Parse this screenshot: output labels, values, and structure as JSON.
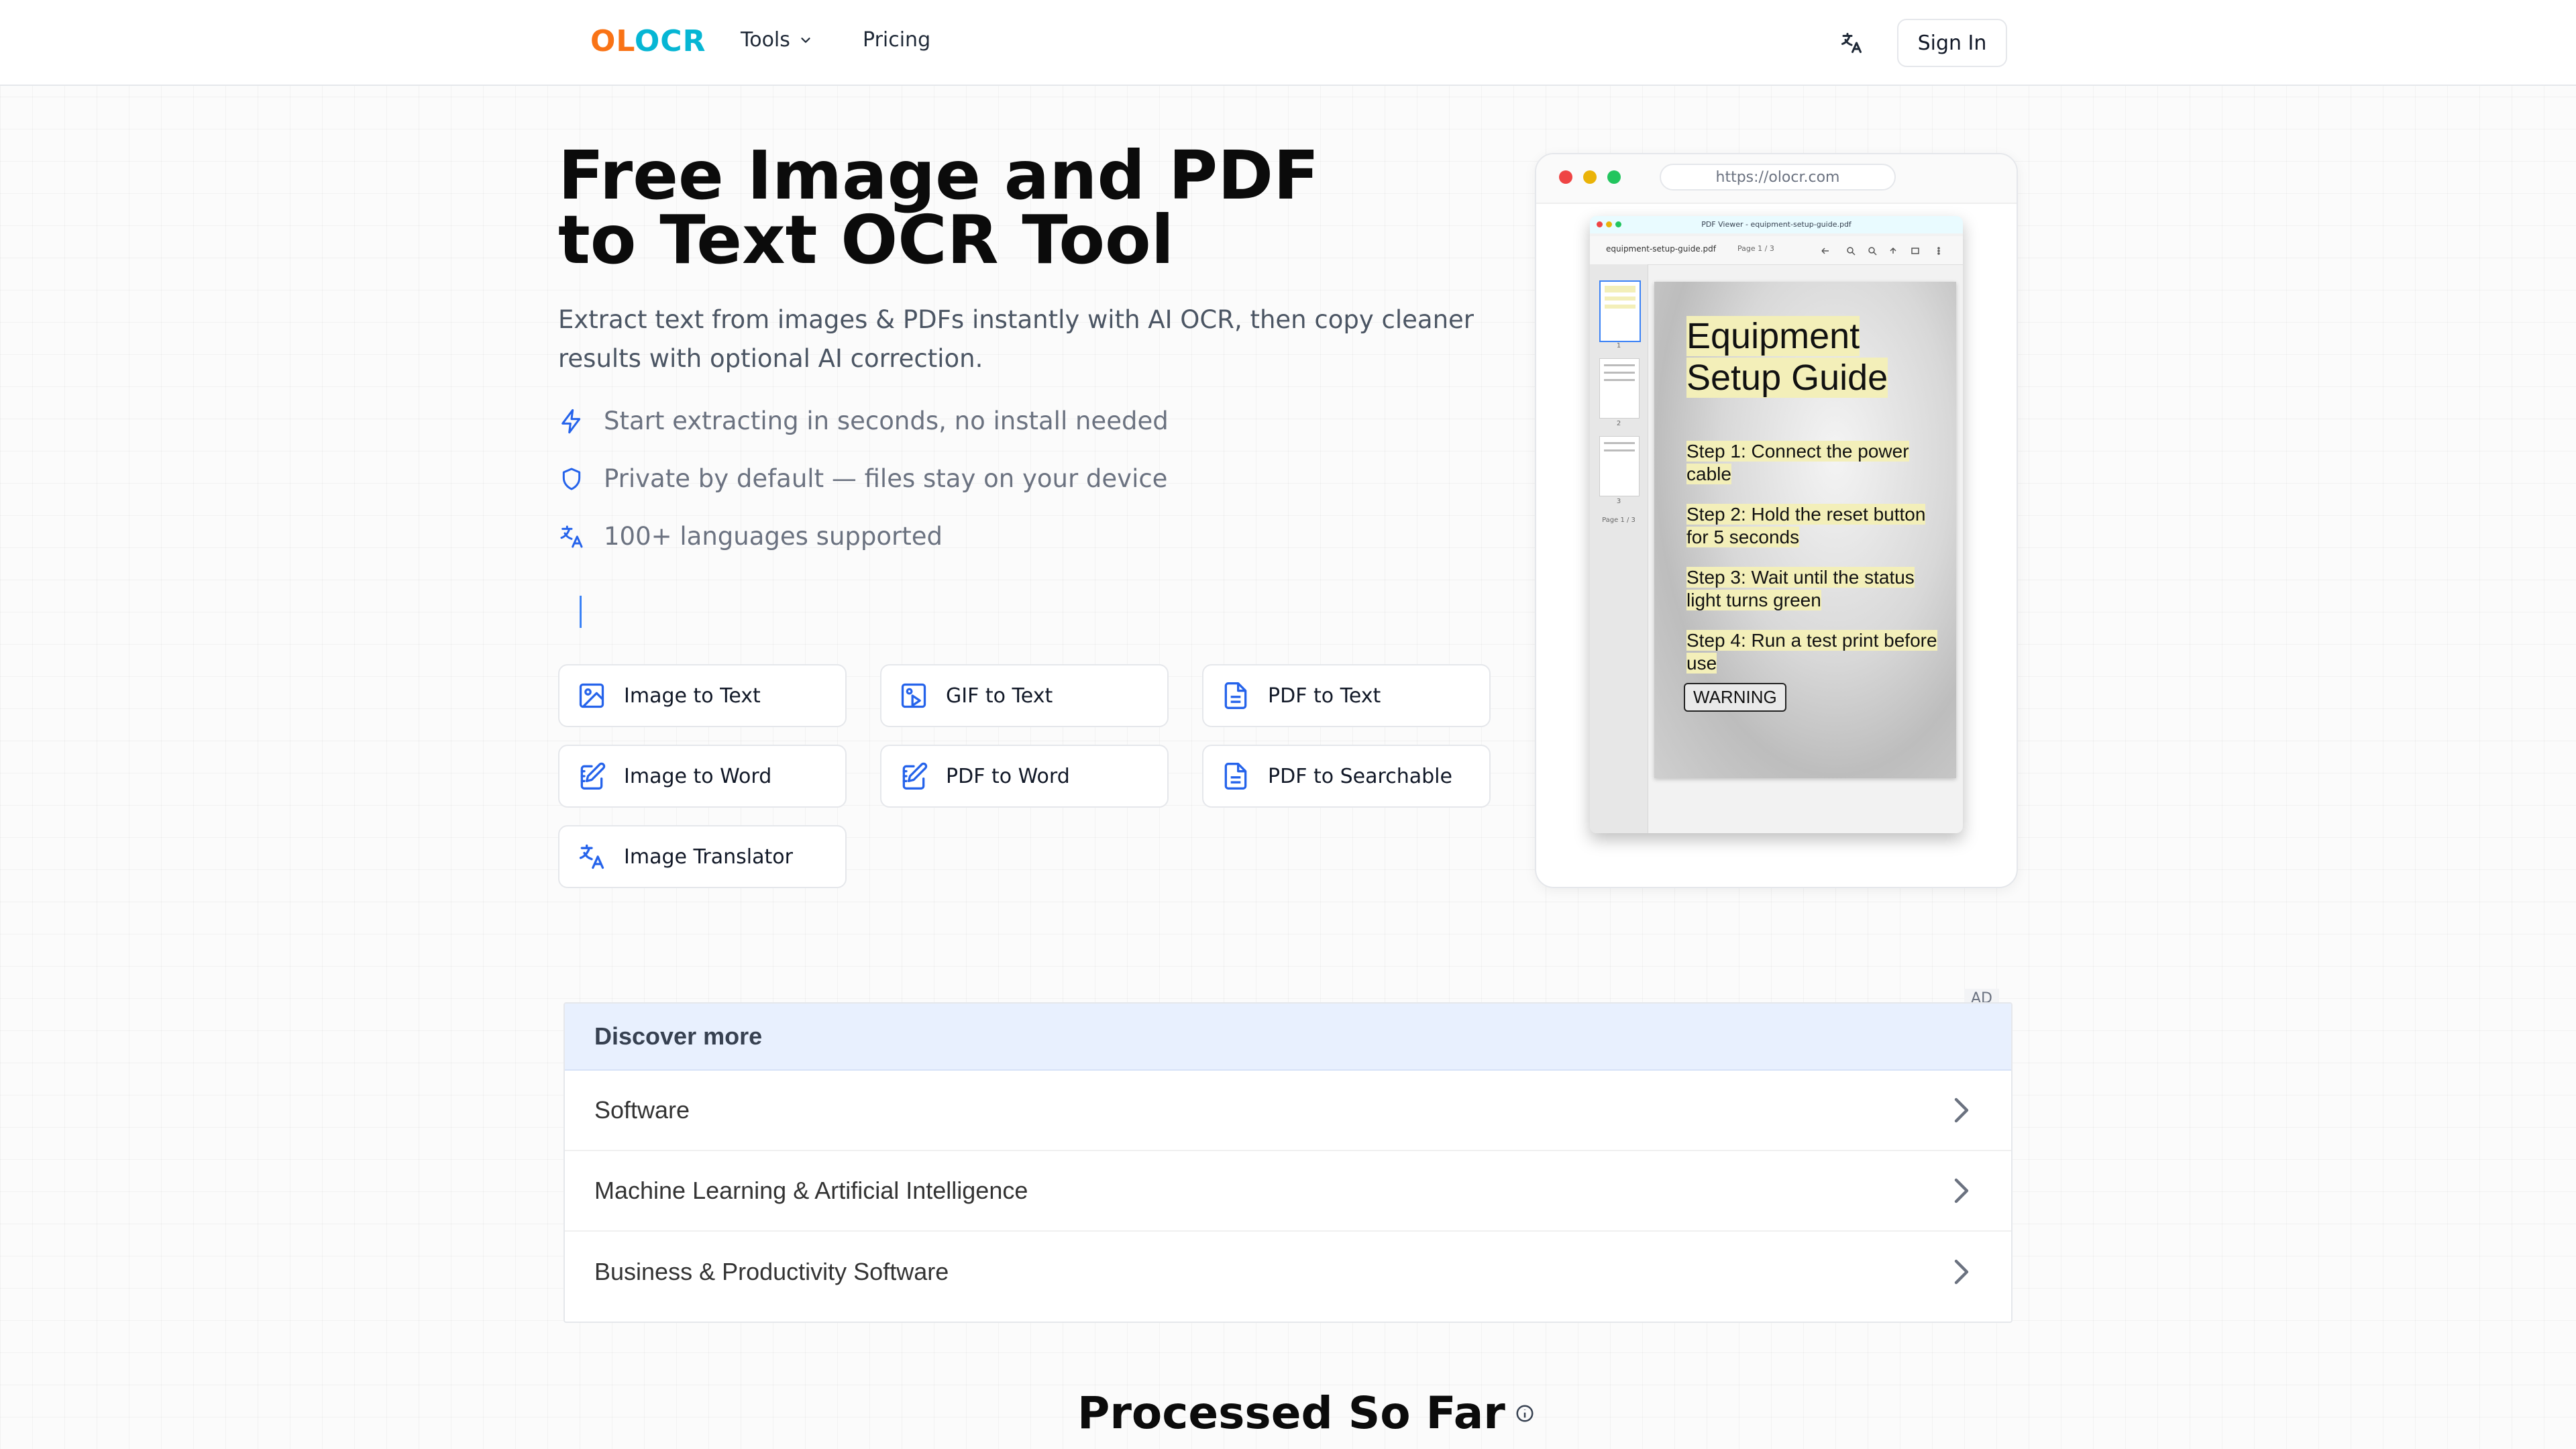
{
  "header": {
    "logo_part1": "OL",
    "logo_part2": "OCR",
    "nav_tools": "Tools",
    "nav_pricing": "Pricing",
    "signin": "Sign In",
    "lang_icon": "translate-icon"
  },
  "hero": {
    "title_line1": "Free Image and PDF",
    "title_line2": "to Text OCR Tool",
    "subtitle": "Extract text from images & PDFs instantly with AI OCR, then copy cleaner results with optional AI correction.",
    "features": [
      {
        "icon": "bolt-icon",
        "text": "Start extracting in seconds, no install needed"
      },
      {
        "icon": "shield-icon",
        "text": "Private by default — files stay on your device"
      },
      {
        "icon": "translate-icon",
        "text": "100+ languages supported"
      }
    ]
  },
  "tools": [
    {
      "icon": "image-icon",
      "label": "Image to Text"
    },
    {
      "icon": "gif-icon",
      "label": "GIF to Text"
    },
    {
      "icon": "document-icon",
      "label": "PDF to Text"
    },
    {
      "icon": "edit-document-icon",
      "label": "Image to Word"
    },
    {
      "icon": "edit-document-icon",
      "label": "PDF to Word"
    },
    {
      "icon": "document-icon",
      "label": "PDF to Searchable"
    },
    {
      "icon": "translate-icon",
      "label": "Image Translator"
    }
  ],
  "preview": {
    "url": "https://olocr.com",
    "viewer_title": "PDF Viewer - equipment-setup-guide.pdf",
    "file_name": "equipment-setup-guide.pdf",
    "page_indicator": "Page 1 / 3",
    "thumb_numbers": [
      "1",
      "2",
      "3"
    ],
    "thumb_page_label": "Page 1 / 3",
    "doc_title": "Equipment Setup Guide",
    "steps": [
      "Step 1: Connect the power cable",
      "Step 2: Hold the reset button for 5 seconds",
      "Step 3: Wait until the status light turns green",
      "Step 4: Run a test print before use"
    ],
    "warning": "WARNING"
  },
  "discover": {
    "ad_label": "AD",
    "title": "Discover more",
    "items": [
      "Software",
      "Machine Learning & Artificial Intelligence",
      "Business & Productivity Software"
    ]
  },
  "stats": {
    "title": "Processed So Far"
  },
  "colors": {
    "logo_orange": "#f97316",
    "logo_cyan": "#06b6d4",
    "icon_blue": "#2563eb",
    "discover_header_bg": "#e8f0fe"
  }
}
